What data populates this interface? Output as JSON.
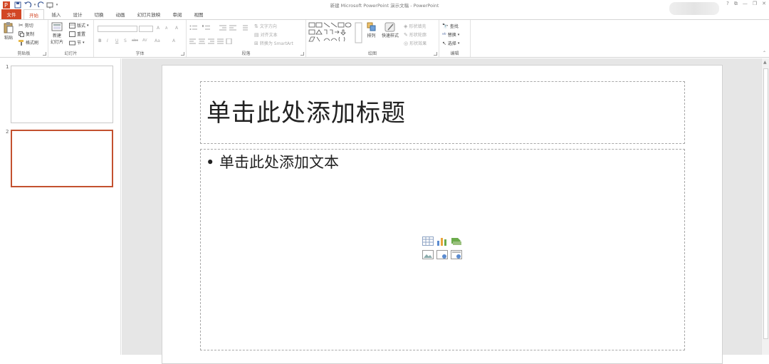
{
  "window": {
    "title": "新建 Microsoft PowerPoint 演示文稿 - PowerPoint",
    "controls": [
      "?",
      "⧉",
      "—",
      "❐",
      "✕"
    ]
  },
  "tabs": [
    {
      "label": "文件"
    },
    {
      "label": "开始"
    },
    {
      "label": "插入"
    },
    {
      "label": "设计"
    },
    {
      "label": "切换"
    },
    {
      "label": "动画"
    },
    {
      "label": "幻灯片放映"
    },
    {
      "label": "审阅"
    },
    {
      "label": "视图"
    }
  ],
  "ribbon": {
    "clipboard": {
      "group_label": "剪贴板",
      "paste": "粘贴",
      "cut": "剪切",
      "copy": "复制",
      "format_painter": "格式刷"
    },
    "slides": {
      "group_label": "幻灯片",
      "new_slide_1": "新建",
      "new_slide_2": "幻灯片",
      "layout": "版式",
      "reset": "重置",
      "section": "节"
    },
    "font": {
      "group_label": "字体",
      "size_up": "A",
      "size_down": "A",
      "clear": "A",
      "bold": "B",
      "italic": "I",
      "underline": "U",
      "shadow": "S",
      "strike": "abc",
      "spacing": "AV",
      "case": "Aa",
      "color": "A"
    },
    "paragraph": {
      "group_label": "段落",
      "text_direction": "文字方向",
      "align_text": "对齐文本",
      "smartart": "转换为 SmartArt"
    },
    "drawing": {
      "group_label": "绘图",
      "arrange": "排列",
      "quick_styles": "快速样式",
      "shape_fill": "形状填充",
      "shape_outline": "形状轮廓",
      "shape_effects": "形状效果"
    },
    "editing": {
      "group_label": "编辑",
      "find": "查找",
      "replace": "替换",
      "select": "选择"
    }
  },
  "thumbnails": [
    {
      "number": "1",
      "selected": false
    },
    {
      "number": "2",
      "selected": true
    }
  ],
  "slide": {
    "title_placeholder": "单击此处添加标题",
    "body_placeholder": "• 单击此处添加文本"
  },
  "colors": {
    "accent": "#d24726",
    "selection": "#c3512f"
  }
}
